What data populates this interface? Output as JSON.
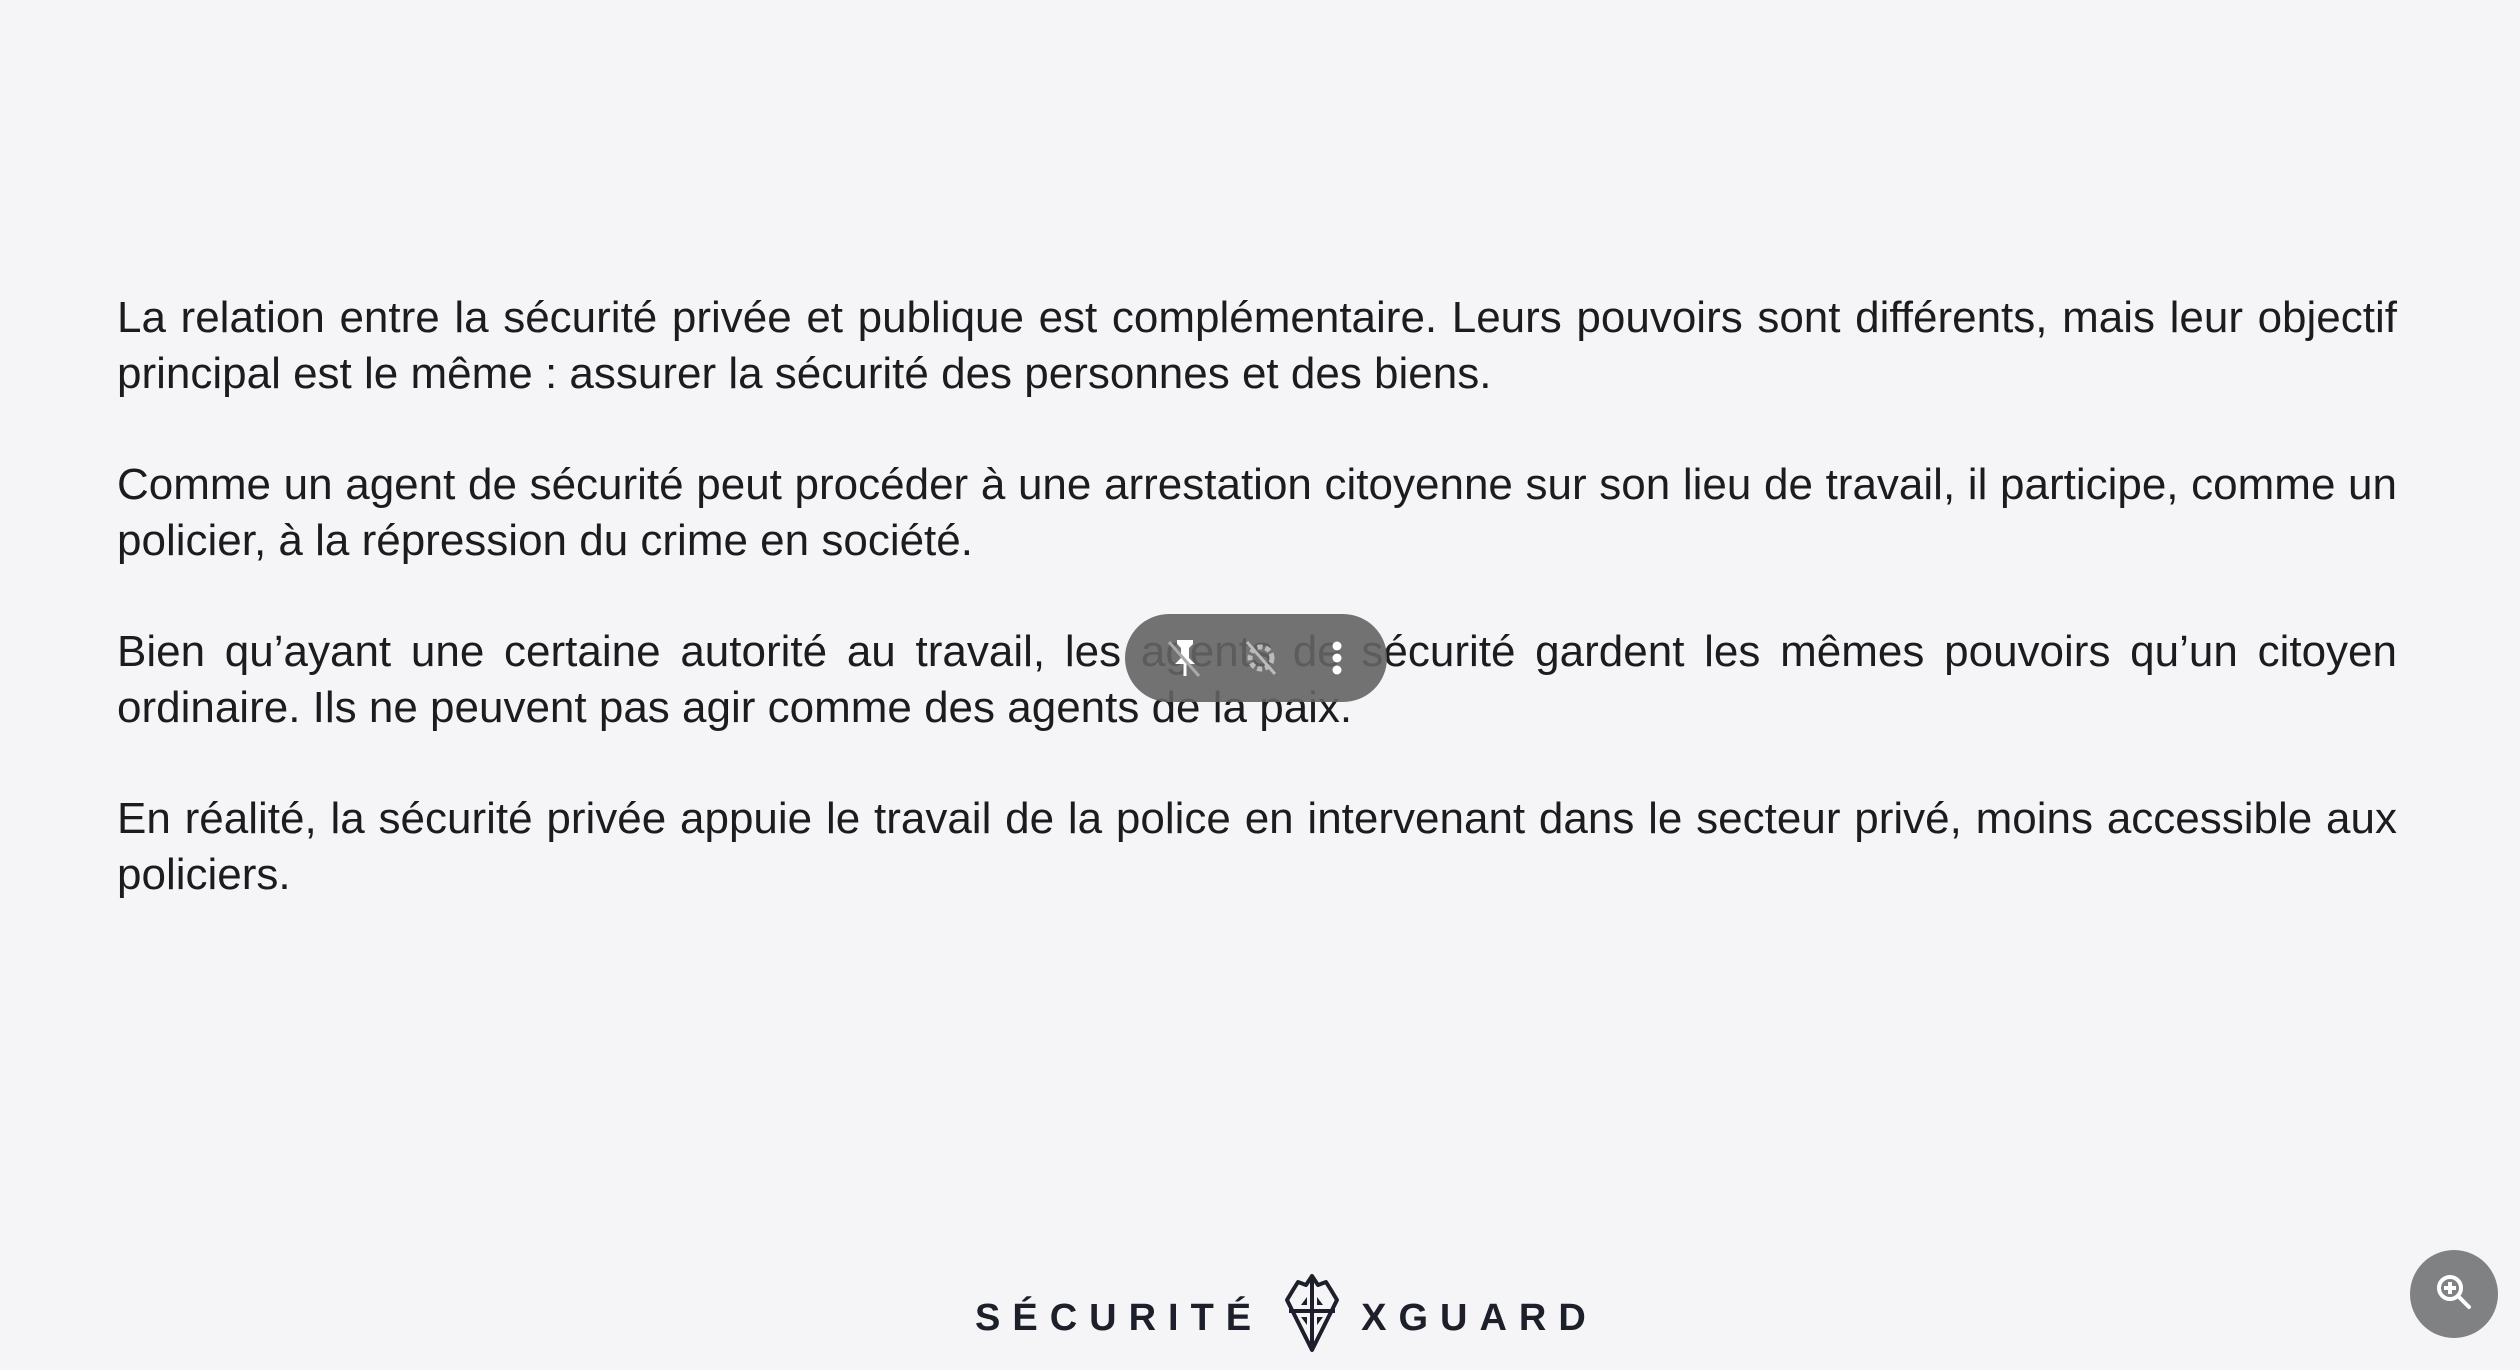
{
  "paragraphs": [
    "La relation entre la sécurité privée et publique est complémentaire. Leurs pouvoirs sont différents, mais leur objectif principal est le même : assurer la sécurité des personnes et des biens.",
    "Comme un agent de sécurité peut procéder à une arrestation citoyenne sur son lieu de travail, il participe, comme un policier, à la répression du crime en société.",
    "Bien qu’ayant une certaine autorité au travail, les agents de sécurité gardent les mêmes pouvoirs qu’un citoyen ordinaire. Ils ne peuvent pas agir comme des agents de la paix.",
    "En réalité, la sécurité privée appuie le travail de la police en intervenant dans le secteur privé, moins accessible aux policiers."
  ],
  "logo": {
    "left": "SÉCURITÉ",
    "right": "XGUARD"
  },
  "toolbar": {
    "icons": [
      "pin-off-icon",
      "settings-off-icon",
      "more-vertical-icon"
    ]
  },
  "zoom_button": {
    "icon": "zoom-in-icon"
  }
}
